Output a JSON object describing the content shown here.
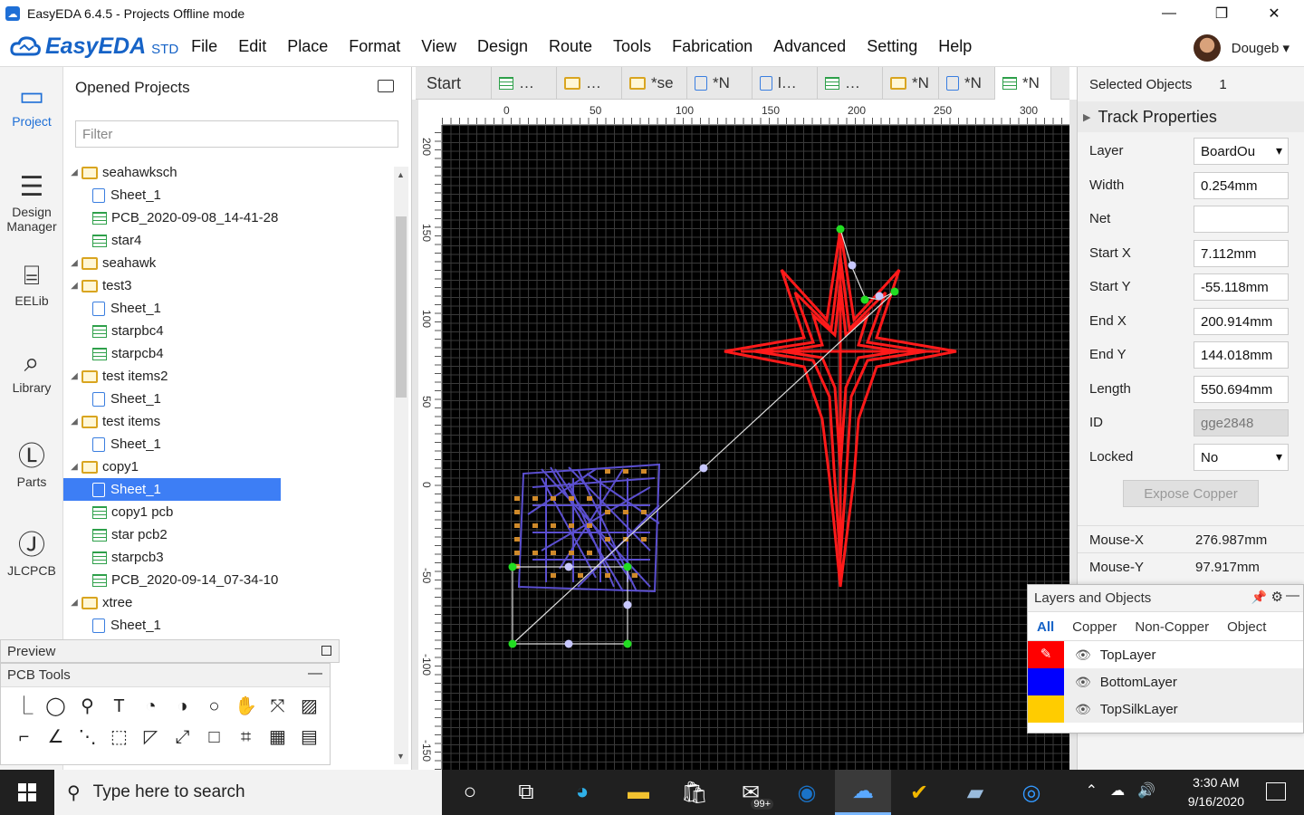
{
  "window": {
    "title": "EasyEDA 6.4.5 - Projects Offline mode",
    "minimize": "—",
    "maximize": "❐",
    "close": "✕"
  },
  "app": {
    "logo_text": "EasyEDA",
    "edition": "STD",
    "user": "Dougeb ▾"
  },
  "menu": [
    "File",
    "Edit",
    "Place",
    "Format",
    "View",
    "Design",
    "Route",
    "Tools",
    "Fabrication",
    "Advanced",
    "Setting",
    "Help"
  ],
  "leftnav": [
    {
      "label": "Project",
      "icon": "folder-icon"
    },
    {
      "label": "Design Manager",
      "icon": "list-icon"
    },
    {
      "label": "EELib",
      "icon": "chip-icon"
    },
    {
      "label": "Library",
      "icon": "library-icon"
    },
    {
      "label": "Parts",
      "icon": "lcsc-icon"
    },
    {
      "label": "JLCPCB",
      "icon": "jlc-icon"
    }
  ],
  "projects": {
    "title": "Opened Projects",
    "filter_placeholder": "Filter",
    "tree": [
      {
        "type": "folder",
        "label": "seahawksch",
        "depth": 0
      },
      {
        "type": "sch",
        "label": "Sheet_1",
        "depth": 1
      },
      {
        "type": "pcb",
        "label": "PCB_2020-09-08_14-41-28",
        "depth": 1
      },
      {
        "type": "pcb",
        "label": "star4",
        "depth": 1
      },
      {
        "type": "folder",
        "label": "seahawk",
        "depth": 0
      },
      {
        "type": "folder",
        "label": "test3",
        "depth": 0
      },
      {
        "type": "sch",
        "label": "Sheet_1",
        "depth": 1
      },
      {
        "type": "pcb",
        "label": "starpbc4",
        "depth": 1
      },
      {
        "type": "pcb",
        "label": "starpcb4",
        "depth": 1
      },
      {
        "type": "folder",
        "label": "test items2",
        "depth": 0
      },
      {
        "type": "sch",
        "label": "Sheet_1",
        "depth": 1
      },
      {
        "type": "folder",
        "label": "test items",
        "depth": 0
      },
      {
        "type": "sch",
        "label": "Sheet_1",
        "depth": 1
      },
      {
        "type": "folder",
        "label": "copy1",
        "depth": 0
      },
      {
        "type": "sch",
        "label": "Sheet_1",
        "depth": 1,
        "selected": true
      },
      {
        "type": "pcb",
        "label": "copy1 pcb",
        "depth": 1
      },
      {
        "type": "pcb",
        "label": "star pcb2",
        "depth": 1
      },
      {
        "type": "pcb",
        "label": "starpcb3",
        "depth": 1
      },
      {
        "type": "pcb",
        "label": "PCB_2020-09-14_07-34-10",
        "depth": 1
      },
      {
        "type": "folder",
        "label": "xtree",
        "depth": 0
      },
      {
        "type": "sch",
        "label": "Sheet_1",
        "depth": 1
      }
    ]
  },
  "preview_label": "Preview",
  "pcb_tools": {
    "title": "PCB Tools",
    "tools": [
      "⎿",
      "◯",
      "⚲",
      "T",
      "◔",
      "◑",
      "○",
      "✋",
      "⤧",
      "▨",
      "⌐",
      "∠",
      "⋱",
      "⬚",
      "◸",
      "⤢",
      "□",
      "⌗",
      "▦",
      "▤"
    ]
  },
  "tabs": [
    {
      "label": "Start"
    },
    {
      "label": "…",
      "icon": "pcb"
    },
    {
      "label": "…",
      "icon": "folder"
    },
    {
      "label": "*se",
      "icon": "folder"
    },
    {
      "label": "*N",
      "icon": "sch"
    },
    {
      "label": "l…",
      "icon": "sch"
    },
    {
      "label": "…",
      "icon": "pcb"
    },
    {
      "label": "*N",
      "icon": "folder"
    },
    {
      "label": "*N",
      "icon": "sch"
    },
    {
      "label": "*N",
      "icon": "pcb",
      "active": true
    }
  ],
  "ruler_top": [
    "0",
    "50",
    "100",
    "150",
    "200",
    "250",
    "300"
  ],
  "ruler_left": [
    "200",
    "150",
    "100",
    "50",
    "0",
    "-50",
    "-100",
    "-150"
  ],
  "props": {
    "selected_label": "Selected Objects",
    "selected_count": "1",
    "section": "Track Properties",
    "rows": [
      {
        "label": "Layer",
        "value": "BoardOu",
        "select": true
      },
      {
        "label": "Width",
        "value": "0.254mm"
      },
      {
        "label": "Net",
        "value": ""
      },
      {
        "label": "Start X",
        "value": "7.112mm"
      },
      {
        "label": "Start Y",
        "value": "-55.118mm"
      },
      {
        "label": "End X",
        "value": "200.914mm"
      },
      {
        "label": "End Y",
        "value": "144.018mm"
      },
      {
        "label": "Length",
        "value": "550.694mm"
      },
      {
        "label": "ID",
        "value": "gge2848",
        "disabled": true
      },
      {
        "label": "Locked",
        "value": "No",
        "select": true
      }
    ],
    "expose": "Expose Copper",
    "mouse_x_label": "Mouse-X",
    "mouse_x": "276.987mm",
    "mouse_y_label": "Mouse-Y",
    "mouse_y": "97.917mm"
  },
  "layers": {
    "title": "Layers and Objects",
    "tabs": [
      "All",
      "Copper",
      "Non-Copper",
      "Object"
    ],
    "rows": [
      {
        "name": "TopLayer",
        "color": "#ff0000"
      },
      {
        "name": "BottomLayer",
        "color": "#0000ff"
      },
      {
        "name": "TopSilkLayer",
        "color": "#ffcc00"
      }
    ]
  },
  "taskbar": {
    "search": "Type here to search",
    "time": "3:30 AM",
    "date": "9/16/2020",
    "mail_badge": "99+"
  }
}
